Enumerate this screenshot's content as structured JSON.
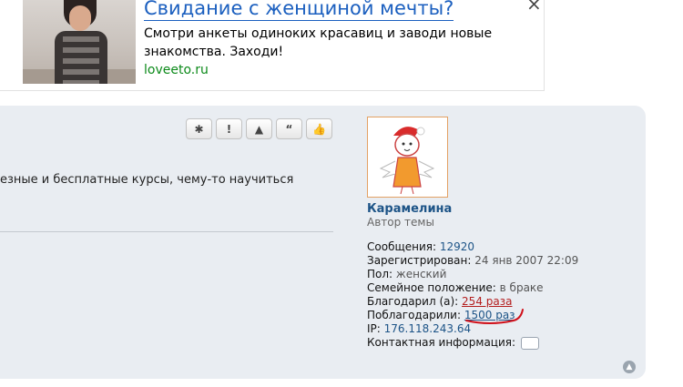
{
  "ad": {
    "title": "Свидание с женщиной мечты?",
    "description": "Смотри анкеты одиноких красавиц и заводи новые знакомства. Заходи!",
    "url": "loveeto.ru",
    "close": "×"
  },
  "toolbar": {
    "buttons": [
      {
        "name": "report",
        "glyph": "✱"
      },
      {
        "name": "warn",
        "glyph": "!"
      },
      {
        "name": "top",
        "glyph": "▲"
      },
      {
        "name": "quote",
        "glyph": "“"
      },
      {
        "name": "like",
        "glyph": "👍"
      }
    ]
  },
  "post": {
    "text": "езные и бесплатные курсы, чему-то научиться"
  },
  "user": {
    "name": "Карамелина",
    "title": "Автор темы",
    "messages_label": "Сообщения:",
    "messages_value": "12920",
    "registered_label": "Зарегистрирован:",
    "registered_value": "24 янв 2007 22:09",
    "gender_label": "Пол:",
    "gender_value": "женский",
    "marital_label": "Семейное положение:",
    "marital_value": "в браке",
    "thanked_label": "Благодарил (а):",
    "thanked_value": "254 раза",
    "was_thanked_label": "Поблагодарили:",
    "was_thanked_value": "1500 раз",
    "ip_label": "IP:",
    "ip_value": "176.118.243.64",
    "contact_label": "Контактная информация:"
  },
  "colors": {
    "link_blue": "#1d5487",
    "ad_title": "#1b5fbf",
    "ad_url": "#0c8a1a",
    "thanked_red": "#b41f1f",
    "panel_bg": "#e9edf2",
    "scribble": "#d0111b"
  }
}
